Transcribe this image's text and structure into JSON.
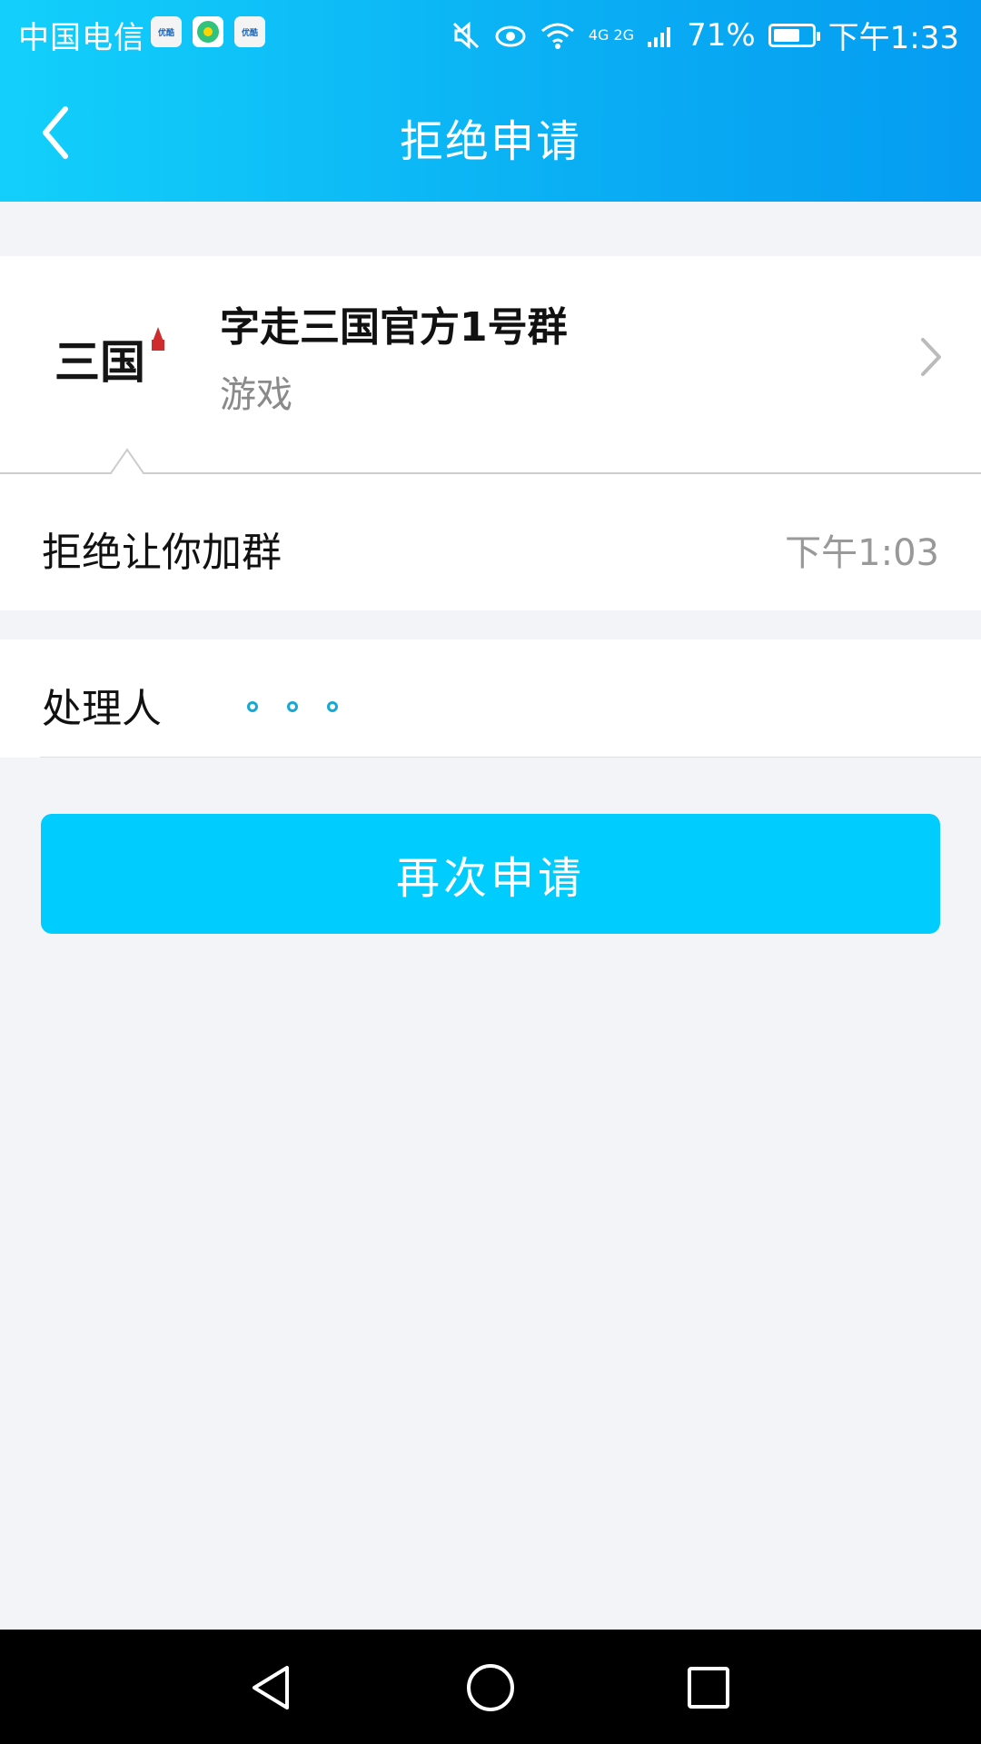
{
  "status_bar": {
    "carrier": "中国电信",
    "app_badges": [
      "youku-app-icon",
      "music-app-icon",
      "youku-app-icon"
    ],
    "badge_text": "优酷",
    "network": "4G 2G",
    "battery_percent": "71%",
    "time": "下午1:33",
    "icons": [
      "mute-icon",
      "eye-icon",
      "wifi-icon",
      "signal-icon",
      "battery-icon"
    ]
  },
  "header": {
    "title": "拒绝申请",
    "back_icon": "back-arrow-icon",
    "background_colors": [
      "#12d0fb",
      "#059cf2"
    ]
  },
  "group": {
    "name": "字走三国官方1号群",
    "tag": "游戏",
    "avatar_text": "三国",
    "chevron_icon": "chevron-right-icon"
  },
  "message": {
    "text": "拒绝让你加群",
    "time": "下午1:03"
  },
  "handler": {
    "label": "处理人",
    "loading_icon": "loading-dots-icon"
  },
  "actions": {
    "reapply_label": "再次申请",
    "button_color": "#00cdfd"
  },
  "system_nav": {
    "buttons": [
      "back-triangle-icon",
      "home-circle-icon",
      "recents-square-icon"
    ]
  }
}
